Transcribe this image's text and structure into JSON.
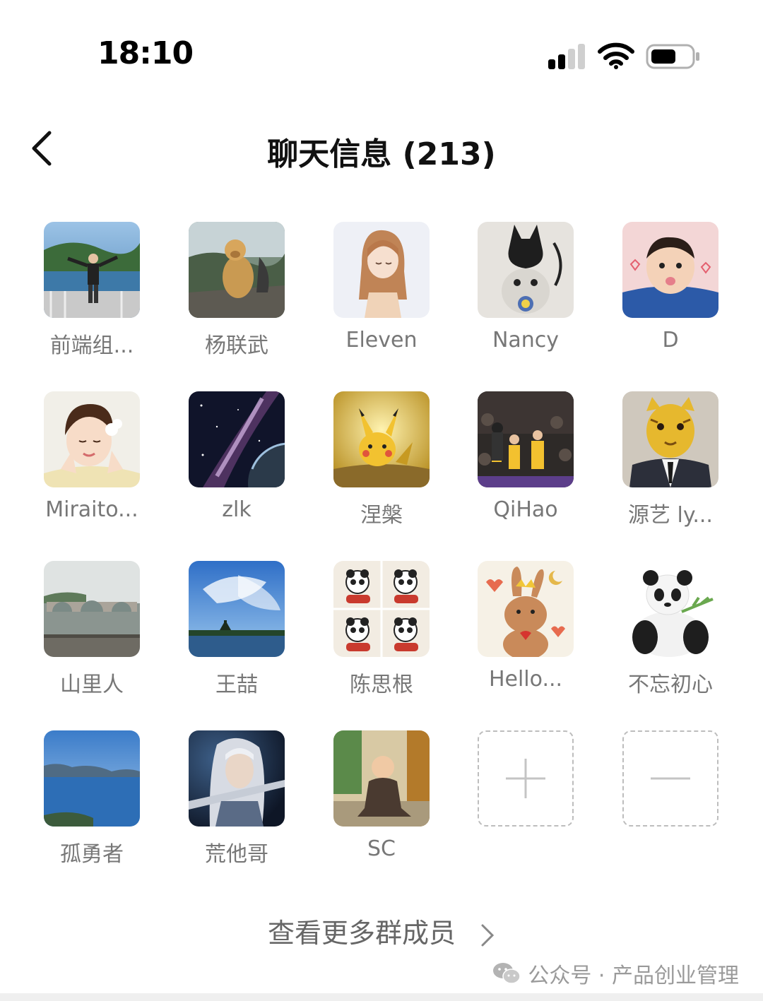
{
  "status_bar": {
    "time": "18:10"
  },
  "header": {
    "title": "聊天信息 (213)"
  },
  "members": [
    {
      "name": "前端组...",
      "avatar": "lake-person"
    },
    {
      "name": "杨联武",
      "avatar": "dog-mountain"
    },
    {
      "name": "Eleven",
      "avatar": "anime-girl"
    },
    {
      "name": "Nancy",
      "avatar": "cat-devil"
    },
    {
      "name": "D",
      "avatar": "baby-blue"
    },
    {
      "name": "Miraito...",
      "avatar": "girl-flower"
    },
    {
      "name": "zlk",
      "avatar": "galaxy"
    },
    {
      "name": "涅槃",
      "avatar": "pikachu"
    },
    {
      "name": "QiHao",
      "avatar": "basketball"
    },
    {
      "name": "源艺 ly...",
      "avatar": "tiger-suit"
    },
    {
      "name": "山里人",
      "avatar": "stone-bridge"
    },
    {
      "name": "王喆",
      "avatar": "sky-lake"
    },
    {
      "name": "陈思根",
      "avatar": "pandas-scooter"
    },
    {
      "name": "Hello...",
      "avatar": "bunny-plush"
    },
    {
      "name": "不忘初心",
      "avatar": "panda-bamboo"
    },
    {
      "name": "孤勇者",
      "avatar": "sea-islands"
    },
    {
      "name": "荒他哥",
      "avatar": "white-hair-warrior"
    },
    {
      "name": "SC",
      "avatar": "little-monk"
    }
  ],
  "actions": [
    {
      "name": "add-member",
      "icon": "plus-icon"
    },
    {
      "name": "remove-member",
      "icon": "minus-icon"
    }
  ],
  "footer": {
    "more_label": "查看更多群成员",
    "watermark": "公众号 · 产品创业管理"
  }
}
